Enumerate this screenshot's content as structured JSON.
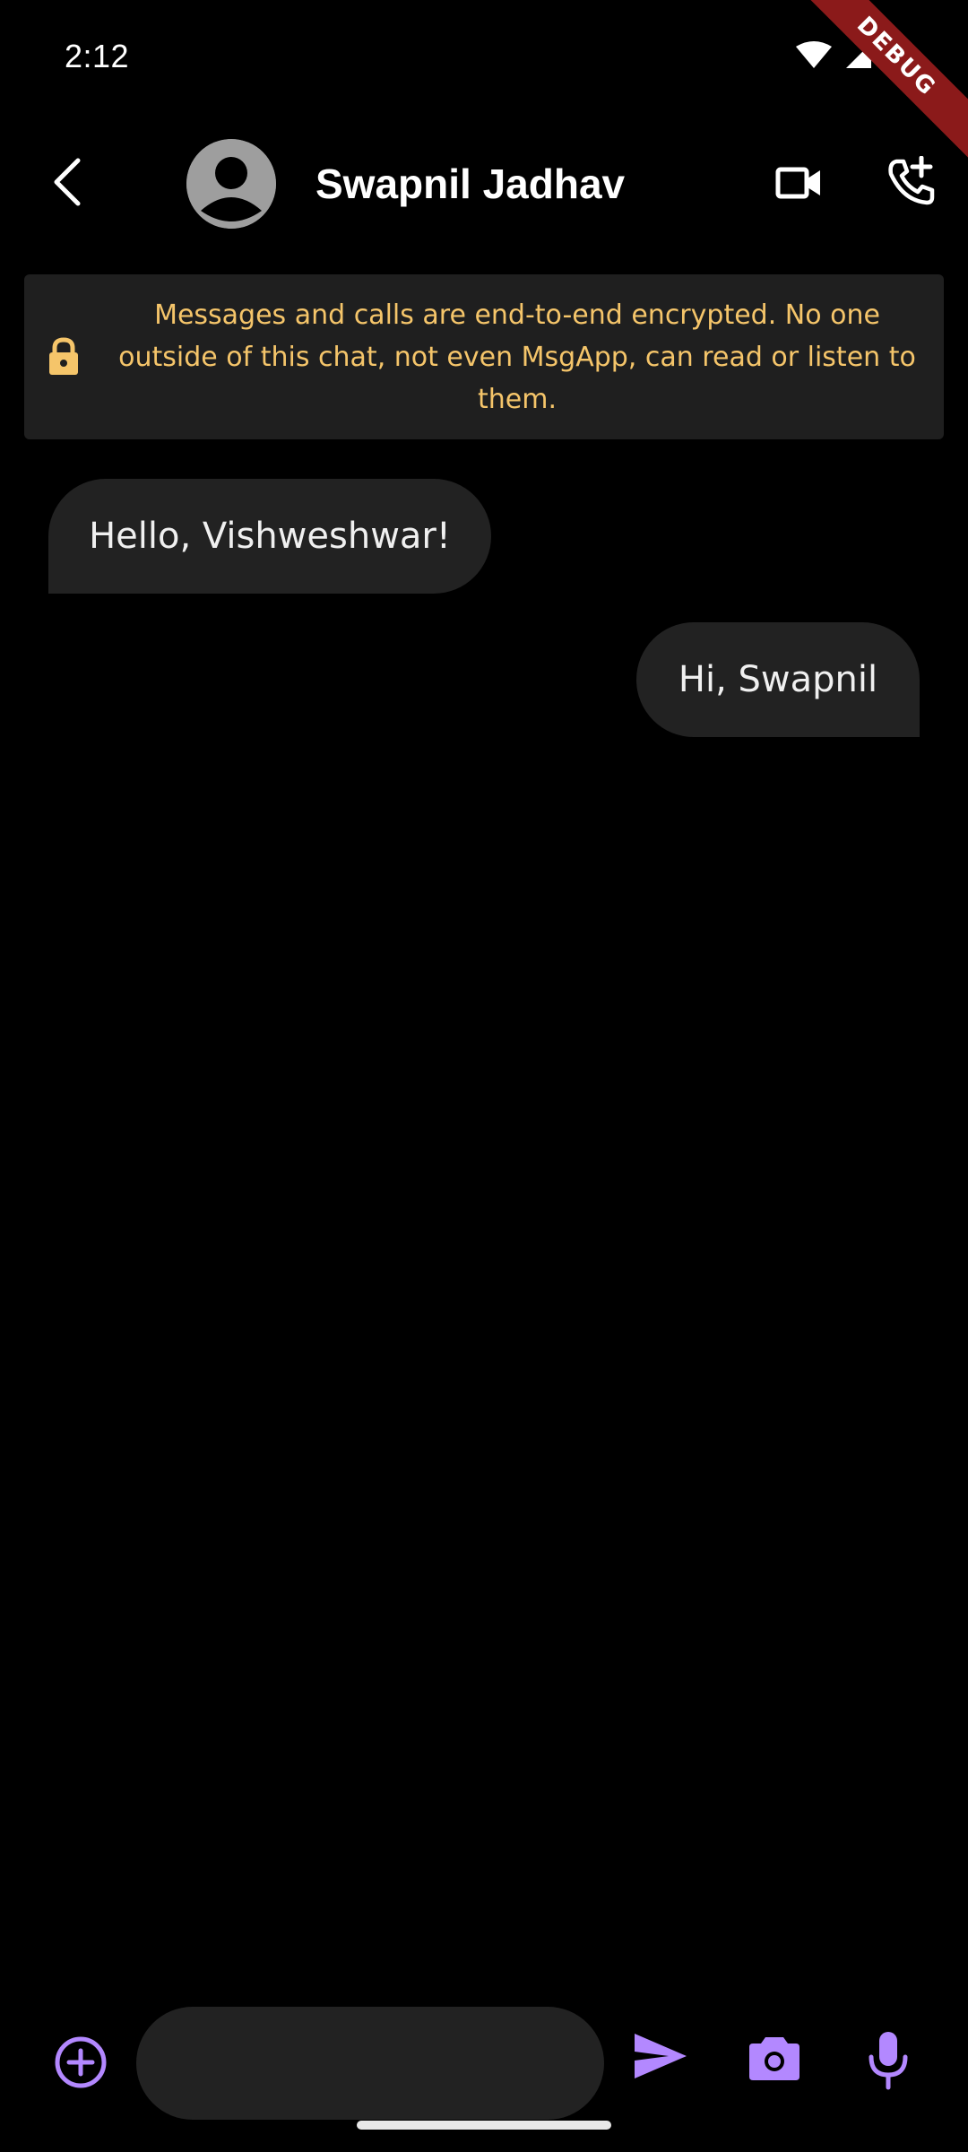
{
  "status_bar": {
    "time": "2:12",
    "debug_label": "DEBUG"
  },
  "app_bar": {
    "contact_name": "Swapnil Jadhav",
    "icons": [
      "back-arrow-icon",
      "avatar-person-icon",
      "video-call-icon",
      "add-call-icon"
    ]
  },
  "banner": {
    "text": "Messages and calls are end-to-end encrypted. No one outside of this chat, not even MsgApp, can read or listen to them.",
    "icon": "lock-icon",
    "text_color": "#f5c56a"
  },
  "messages": [
    {
      "direction": "incoming",
      "text": "Hello, Vishweshwar!"
    },
    {
      "direction": "outgoing",
      "text": "Hi, Swapnil"
    }
  ],
  "composer": {
    "input_value": "",
    "icons": [
      "add-circle-icon",
      "send-icon",
      "camera-icon",
      "mic-icon"
    ],
    "accent_color": "#b388ff"
  },
  "colors": {
    "background": "#000000",
    "bubble": "#222222",
    "banner_bg": "#1f1f1f",
    "debug_ribbon": "#8b1a1a"
  }
}
